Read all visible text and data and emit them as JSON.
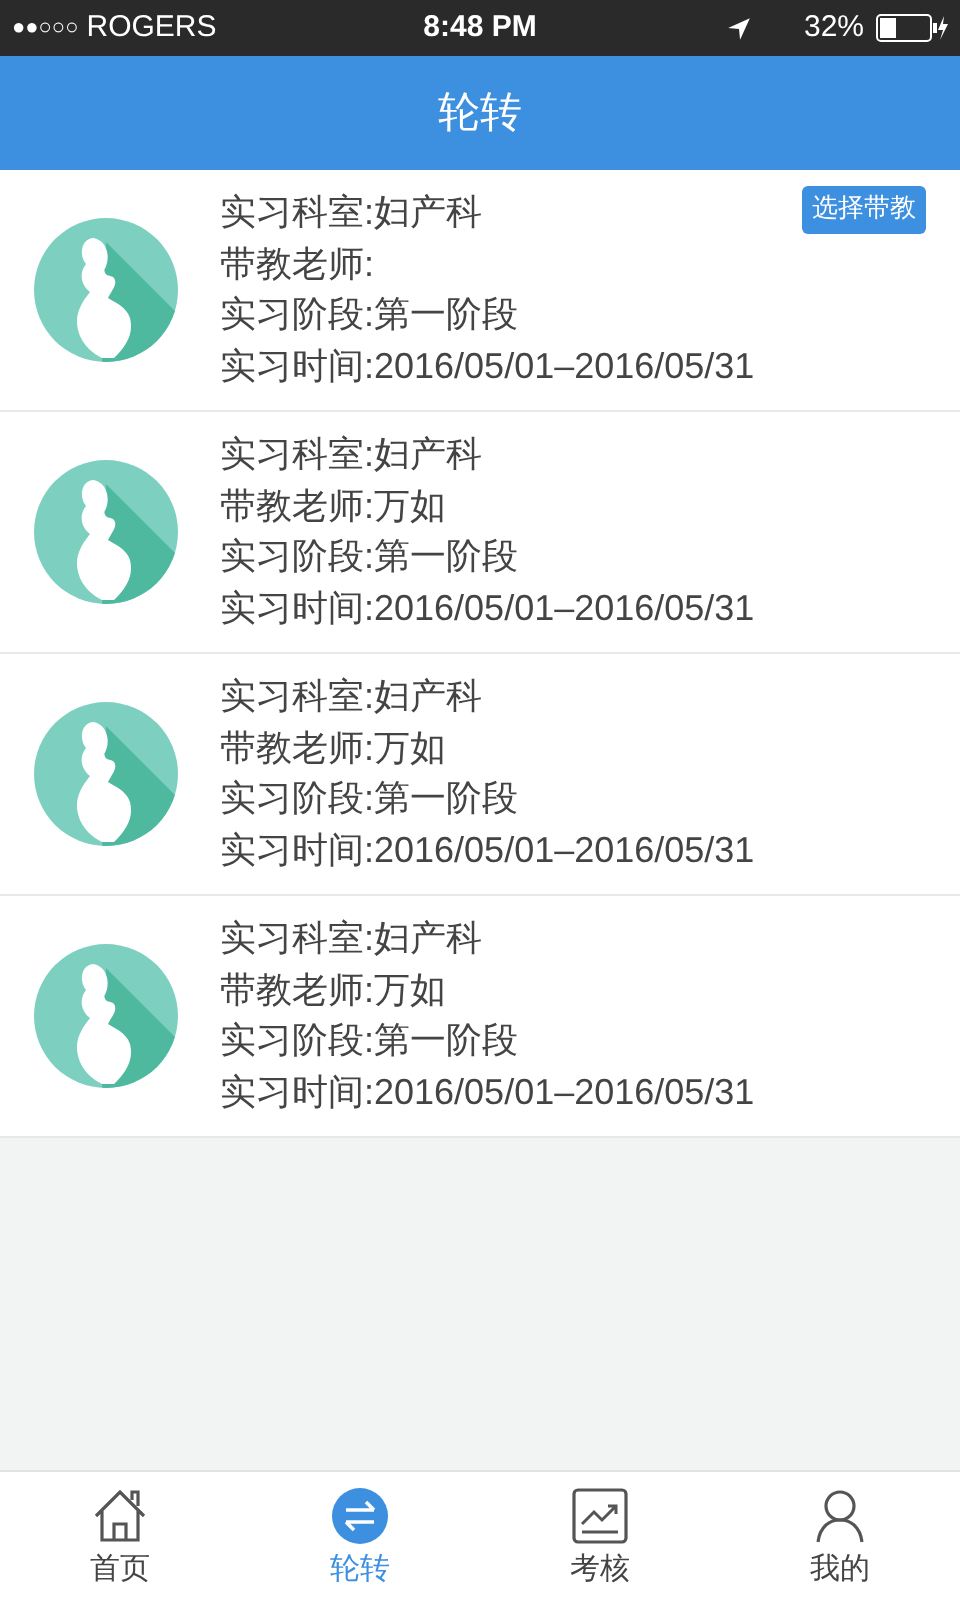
{
  "status_bar": {
    "signal": "●●○○○",
    "carrier": "ROGERS",
    "time": "8:48 PM",
    "battery": "32%"
  },
  "header": {
    "title": "轮转"
  },
  "rows": [
    {
      "department": "实习科室:妇产科",
      "teacher": "带教老师:",
      "stage": "实习阶段:第一阶段",
      "period": "实习时间:2016/05/01–2016/05/31",
      "action": "选择带教"
    },
    {
      "department": "实习科室:妇产科",
      "teacher": "带教老师:万如",
      "stage": "实习阶段:第一阶段",
      "period": "实习时间:2016/05/01–2016/05/31"
    },
    {
      "department": "实习科室:妇产科",
      "teacher": "带教老师:万如",
      "stage": "实习阶段:第一阶段",
      "period": "实习时间:2016/05/01–2016/05/31"
    },
    {
      "department": "实习科室:妇产科",
      "teacher": "带教老师:万如",
      "stage": "实习阶段:第一阶段",
      "period": "实习时间:2016/05/01–2016/05/31"
    }
  ],
  "tabs": [
    {
      "label": "首页",
      "kind": "home",
      "selected": false
    },
    {
      "label": "轮转",
      "kind": "swap",
      "selected": true
    },
    {
      "label": "考核",
      "kind": "chart",
      "selected": false
    },
    {
      "label": "我的",
      "kind": "person",
      "selected": false
    }
  ]
}
